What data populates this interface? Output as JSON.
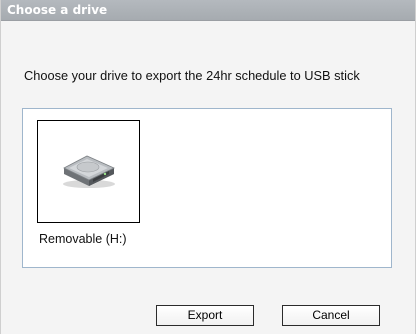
{
  "window": {
    "title": "Choose a drive"
  },
  "prompt": "Choose your drive to export the 24hr schedule to USB stick",
  "drives": [
    {
      "label": "Removable (H:)",
      "icon": "removable-drive-icon"
    }
  ],
  "buttons": {
    "export_label": "Export",
    "cancel_label": "Cancel"
  },
  "colors": {
    "titlebar": "#acb1b6",
    "titlebar_text": "#ffffff",
    "panel_border": "#9fb6cc",
    "dialog_bg": "#f4f4f4"
  }
}
